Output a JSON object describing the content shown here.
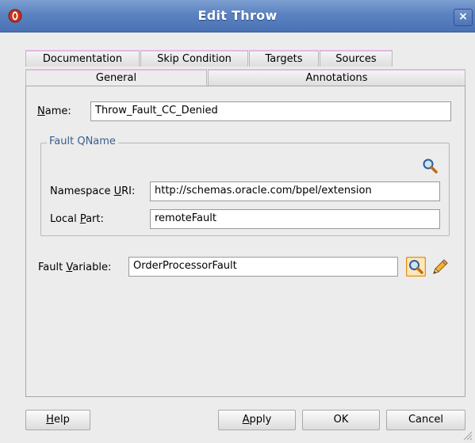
{
  "window": {
    "title": "Edit Throw",
    "close_glyph": "×"
  },
  "tabs": {
    "row1": [
      "Documentation",
      "Skip Condition",
      "Targets",
      "Sources"
    ],
    "row2": [
      "General",
      "Annotations"
    ],
    "active": "General"
  },
  "form": {
    "name_label": "Name:",
    "name_value": "Throw_Fault_CC_Denied",
    "group_title": "Fault QName",
    "namespace_label": "Namespace URI:",
    "namespace_value": "http://schemas.oracle.com/bpel/extension",
    "local_part_label": "Local Part:",
    "local_part_value": "remoteFault",
    "fault_variable_label": "Fault Variable:",
    "fault_variable_value": "OrderProcessorFault"
  },
  "buttons": {
    "help": "Help",
    "apply": "Apply",
    "ok": "OK",
    "cancel": "Cancel"
  },
  "icons": {
    "app": "oracle-app-icon",
    "qname_browse": "search-icon",
    "variable_browse": "search-icon",
    "variable_create": "pencil-icon"
  },
  "colors": {
    "titlebar": "#5b82c0",
    "tab_accent": "#e3b8e0",
    "group_title": "#3a5d8c"
  }
}
